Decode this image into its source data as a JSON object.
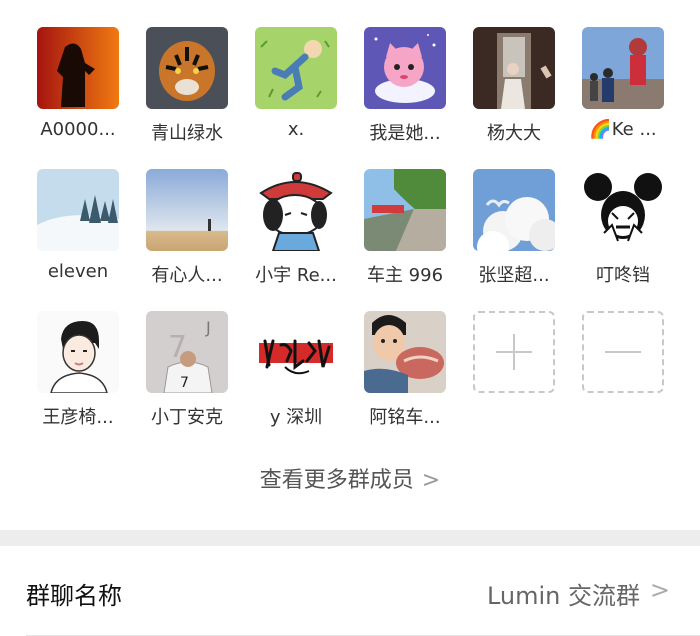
{
  "members": [
    {
      "name": "A0000...",
      "avatar": "soldier-fire-avatar"
    },
    {
      "name": "青山绿水",
      "avatar": "tiger-avatar"
    },
    {
      "name": "x.",
      "avatar": "cartoon-boy-grass-avatar"
    },
    {
      "name": "我是她...",
      "avatar": "pink-cat-cartoon-avatar"
    },
    {
      "name": "杨大大",
      "avatar": "girl-doorway-avatar"
    },
    {
      "name": "🌈Ke ...",
      "avatar": "street-people-avatar"
    },
    {
      "name": "eleven",
      "avatar": "snow-trees-avatar"
    },
    {
      "name": "有心人...",
      "avatar": "beach-sky-avatar"
    },
    {
      "name": "小宇 Re...",
      "avatar": "cartoon-dog-hat-avatar"
    },
    {
      "name": "车主 996",
      "avatar": "road-trees-avatar"
    },
    {
      "name": "张坚超...",
      "avatar": "clouds-avatar"
    },
    {
      "name": "叮咚铛",
      "avatar": "mickey-avatar"
    },
    {
      "name": "王彦椅...",
      "avatar": "cartoon-man-avatar"
    },
    {
      "name": "小丁安克",
      "avatar": "football-player-avatar"
    },
    {
      "name": "y 深圳",
      "avatar": "calligraphy-avatar"
    },
    {
      "name": "阿铭车...",
      "avatar": "boy-eating-avatar"
    }
  ],
  "add_button_label": "+",
  "remove_button_label": "—",
  "more_members": "查看更多群成员",
  "group_name_label": "群聊名称",
  "group_name_value": "Lumin 交流群",
  "colors": {
    "divider": "#ededed",
    "dashed_border": "#c8c8c8",
    "text_secondary": "#666666"
  }
}
